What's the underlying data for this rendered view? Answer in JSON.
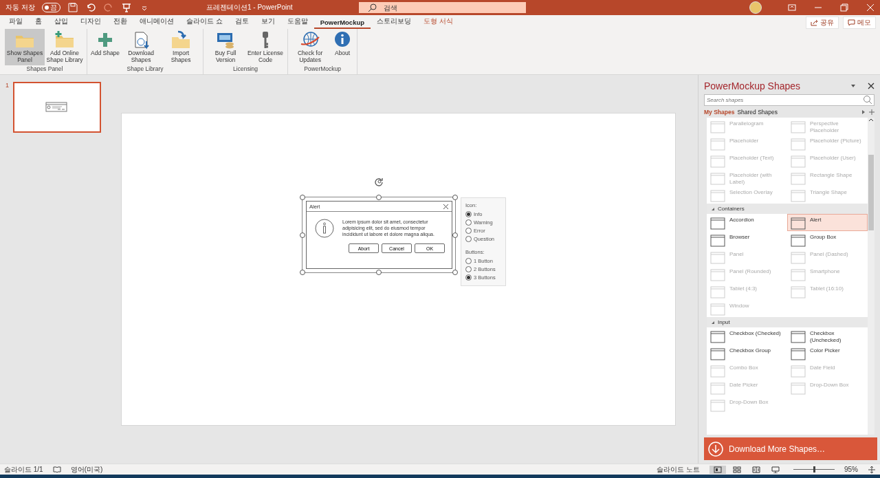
{
  "title_bar": {
    "autosave_label": "자동 저장",
    "autosave_state": "끔",
    "autosave_on": false,
    "title": "프레젠테이션1  -  PowerPoint",
    "search_placeholder": "검색"
  },
  "tabs": [
    {
      "label": "파일",
      "selected": false,
      "kind": "normal"
    },
    {
      "label": "홈",
      "selected": false,
      "kind": "normal"
    },
    {
      "label": "삽입",
      "selected": false,
      "kind": "normal"
    },
    {
      "label": "디자인",
      "selected": false,
      "kind": "normal"
    },
    {
      "label": "전환",
      "selected": false,
      "kind": "normal"
    },
    {
      "label": "애니메이션",
      "selected": false,
      "kind": "normal"
    },
    {
      "label": "슬라이드 쇼",
      "selected": false,
      "kind": "normal"
    },
    {
      "label": "검토",
      "selected": false,
      "kind": "normal"
    },
    {
      "label": "보기",
      "selected": false,
      "kind": "normal"
    },
    {
      "label": "도움말",
      "selected": false,
      "kind": "normal"
    },
    {
      "label": "PowerMockup",
      "selected": true,
      "kind": "normal"
    },
    {
      "label": "스토리보딩",
      "selected": false,
      "kind": "normal"
    },
    {
      "label": "도형 서식",
      "selected": false,
      "kind": "contextual"
    }
  ],
  "share_buttons": [
    {
      "label": "공유",
      "kind": "share"
    },
    {
      "label": "메모",
      "kind": "comment"
    }
  ],
  "ribbon": [
    {
      "label": "Shapes Panel",
      "buttons": [
        {
          "label": "Show Shapes Panel",
          "kind": "folder",
          "selected": true
        },
        {
          "label": "Add Online Shape Library",
          "kind": "addfolder",
          "selected": false
        }
      ]
    },
    {
      "label": "Shape Library",
      "buttons": [
        {
          "label": "Add Shape",
          "kind": "plus",
          "selected": false
        },
        {
          "label": "Download Shapes",
          "kind": "download",
          "selected": false
        },
        {
          "label": "Import Shapes",
          "kind": "import",
          "selected": false
        }
      ]
    },
    {
      "label": "Licensing",
      "buttons": [
        {
          "label": "Buy Full Version",
          "kind": "money",
          "selected": false
        },
        {
          "label": "Enter License Code",
          "kind": "key",
          "selected": false
        }
      ]
    },
    {
      "label": "PowerMockup",
      "buttons": [
        {
          "label": "Check for Updates",
          "kind": "globe",
          "selected": false
        },
        {
          "label": "About",
          "kind": "info",
          "selected": false
        }
      ]
    }
  ],
  "thumbnails": [
    {
      "number": "1",
      "selected": true
    }
  ],
  "slide": {
    "alert": {
      "title": "Alert",
      "message": "Lorem ipsum dolor sit amet, consectetur adipisicing elit, sed do eiusmod tempor incididunt ut labore et dolore magna aliqua.",
      "buttons": [
        "Abort",
        "Cancel",
        "OK"
      ]
    },
    "options": [
      {
        "heading": "Icon:",
        "choices": [
          {
            "label": "Info",
            "selected": true
          },
          {
            "label": "Warning",
            "selected": false
          },
          {
            "label": "Error",
            "selected": false
          },
          {
            "label": "Question",
            "selected": false
          }
        ]
      },
      {
        "heading": "Buttons:",
        "choices": [
          {
            "label": "1 Button",
            "selected": false
          },
          {
            "label": "2 Buttons",
            "selected": false
          },
          {
            "label": "3 Buttons",
            "selected": true
          }
        ]
      }
    ]
  },
  "shapes_panel": {
    "title": "PowerMockup Shapes",
    "search_placeholder": "Search shapes",
    "tabs": [
      {
        "label": "My Shapes",
        "selected": true
      },
      {
        "label": "Shared Shapes",
        "selected": false
      }
    ],
    "sections": [
      {
        "items": [
          {
            "label": "Parallelogram",
            "disabled": true,
            "selected": false
          },
          {
            "label": "Perspective Placeholder",
            "disabled": true,
            "selected": false
          },
          {
            "label": "Placeholder",
            "disabled": true,
            "selected": false
          },
          {
            "label": "Placeholder (Picture)",
            "disabled": true,
            "selected": false
          },
          {
            "label": "Placeholder (Text)",
            "disabled": true,
            "selected": false
          },
          {
            "label": "Placeholder (User)",
            "disabled": true,
            "selected": false
          },
          {
            "label": "Placeholder (with Label)",
            "disabled": true,
            "selected": false
          },
          {
            "label": "Rectangle Shape",
            "disabled": true,
            "selected": false
          },
          {
            "label": "Selection Overlay",
            "disabled": true,
            "selected": false
          },
          {
            "label": "Triangle Shape",
            "disabled": true,
            "selected": false
          }
        ]
      },
      {
        "title": "Containers",
        "items": [
          {
            "label": "Accordion",
            "disabled": false,
            "selected": false
          },
          {
            "label": "Alert",
            "disabled": false,
            "selected": true
          },
          {
            "label": "Browser",
            "disabled": false,
            "selected": false
          },
          {
            "label": "Group Box",
            "disabled": false,
            "selected": false
          },
          {
            "label": "Panel",
            "disabled": true,
            "selected": false
          },
          {
            "label": "Panel (Dashed)",
            "disabled": true,
            "selected": false
          },
          {
            "label": "Panel (Rounded)",
            "disabled": true,
            "selected": false
          },
          {
            "label": "Smartphone",
            "disabled": true,
            "selected": false
          },
          {
            "label": "Tablet (4:3)",
            "disabled": true,
            "selected": false
          },
          {
            "label": "Tablet (16:10)",
            "disabled": true,
            "selected": false
          },
          {
            "label": "Window",
            "disabled": true,
            "selected": false
          }
        ]
      },
      {
        "title": "Input",
        "items": [
          {
            "label": "Checkbox (Checked)",
            "disabled": false,
            "selected": false
          },
          {
            "label": "Checkbox (Unchecked)",
            "disabled": false,
            "selected": false
          },
          {
            "label": "Checkbox Group",
            "disabled": false,
            "selected": false
          },
          {
            "label": "Color Picker",
            "disabled": false,
            "selected": false
          },
          {
            "label": "Combo Box",
            "disabled": true,
            "selected": false
          },
          {
            "label": "Date Field",
            "disabled": true,
            "selected": false
          },
          {
            "label": "Date Picker",
            "disabled": true,
            "selected": false
          },
          {
            "label": "Drop-Down Box",
            "disabled": true,
            "selected": false
          },
          {
            "label": "Drop-Down Box",
            "disabled": true,
            "selected": false
          }
        ]
      }
    ],
    "download_label": "Download More Shapes…"
  },
  "status_bar": {
    "slide": "슬라이드 1/1",
    "language": "영어(미국)",
    "notes": "슬라이드 노트",
    "views": [
      {
        "kind": "normal",
        "selected": true
      },
      {
        "kind": "sorter",
        "selected": false
      },
      {
        "kind": "reading",
        "selected": false
      },
      {
        "kind": "show",
        "selected": false
      }
    ],
    "level": 0.5,
    "zoom": "95%"
  }
}
